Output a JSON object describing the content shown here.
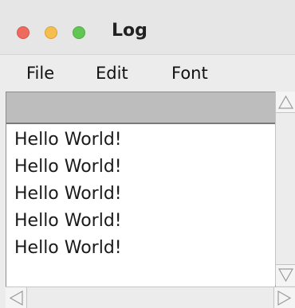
{
  "window": {
    "title": "Log",
    "controls": {
      "close_color": "#ee6a5f",
      "minimize_color": "#f5be4f",
      "maximize_color": "#62c655"
    }
  },
  "menubar": {
    "items": [
      {
        "label": "File"
      },
      {
        "label": "Edit"
      },
      {
        "label": "Font"
      }
    ]
  },
  "log": {
    "lines": [
      "Hello World!",
      "Hello World!",
      "Hello World!",
      "Hello World!",
      "Hello World!"
    ]
  },
  "icons": {
    "scroll_up": "arrow-up-icon",
    "scroll_down": "arrow-down-icon",
    "scroll_left": "arrow-left-icon",
    "scroll_right": "arrow-right-icon"
  }
}
